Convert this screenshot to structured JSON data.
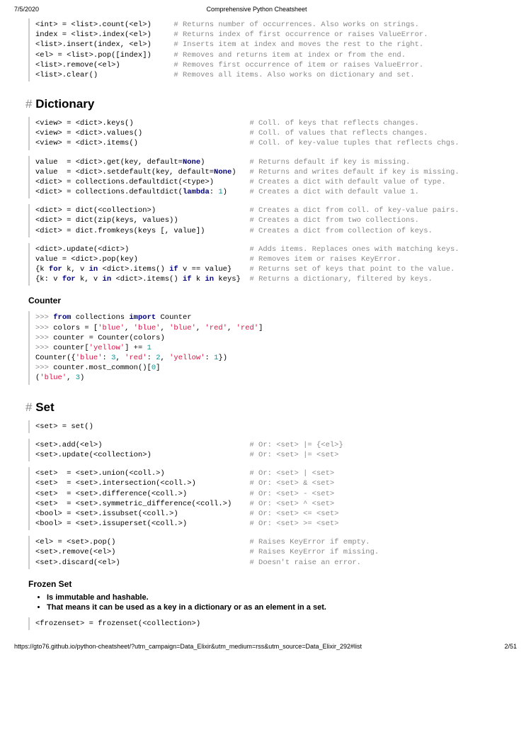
{
  "header": {
    "date": "7/5/2020",
    "title": "Comprehensive Python Cheatsheet"
  },
  "footer": {
    "url": "https://gto76.github.io/python-cheatsheet/?utm_campaign=Data_Elixir&utm_medium=rss&utm_source=Data_Elixir_292#list",
    "page": "2/51"
  },
  "sections": {
    "dictionary": {
      "hash": "#",
      "title": "Dictionary"
    },
    "set": {
      "hash": "#",
      "title": "Set"
    }
  },
  "subsections": {
    "counter": "Counter",
    "frozenset": "Frozen Set"
  },
  "bullets": {
    "fs1": "Is immutable and hashable.",
    "fs2": "That means it can be used as a key in a dictionary or as an element in a set."
  },
  "code": {
    "list_ops": "<int> = <list>.count(<el>)     # Returns number of occurrences. Also works on strings.\nindex = <list>.index(<el>)     # Returns index of first occurrence or raises ValueError.\n<list>.insert(index, <el>)     # Inserts item at index and moves the rest to the right.\n<el> = <list>.pop([index])     # Removes and returns item at index or from the end.\n<list>.remove(<el>)            # Removes first occurrence of item or raises ValueError.\n<list>.clear()                 # Removes all items. Also works on dictionary and set.",
    "dict_views": "<view> = <dict>.keys()                          # Coll. of keys that reflects changes.\n<view> = <dict>.values()                        # Coll. of values that reflects changes.\n<view> = <dict>.items()                         # Coll. of key-value tuples that reflects chgs.",
    "dict_get": "value  = <dict>.get(key, default=None)          # Returns default if key is missing.\nvalue  = <dict>.setdefault(key, default=None)   # Returns and writes default if key is missing.\n<dict> = collections.defaultdict(<type>)        # Creates a dict with default value of type.\n<dict> = collections.defaultdict(lambda: 1)     # Creates a dict with default value 1.",
    "dict_create": "<dict> = dict(<collection>)                     # Creates a dict from coll. of key-value pairs.\n<dict> = dict(zip(keys, values))                # Creates a dict from two collections.\n<dict> = dict.fromkeys(keys [, value])          # Creates a dict from collection of keys.",
    "dict_update": "<dict>.update(<dict>)                           # Adds items. Replaces ones with matching keys.\nvalue = <dict>.pop(key)                         # Removes item or raises KeyError.\n{k for k, v in <dict>.items() if v == value}    # Returns set of keys that point to the value.\n{k: v for k, v in <dict>.items() if k in keys}  # Returns a dictionary, filtered by keys.",
    "counter_ex": ">>> from collections import Counter\n>>> colors = ['blue', 'blue', 'blue', 'red', 'red']\n>>> counter = Counter(colors)\n>>> counter['yellow'] += 1\nCounter({'blue': 3, 'red': 2, 'yellow': 1})\n>>> counter.most_common()[0]\n('blue', 3)",
    "set_new": "<set> = set()",
    "set_add": "<set>.add(<el>)                                 # Or: <set> |= {<el>}\n<set>.update(<collection>)                      # Or: <set> |= <set>",
    "set_ops": "<set>  = <set>.union(<coll.>)                   # Or: <set> | <set>\n<set>  = <set>.intersection(<coll.>)            # Or: <set> & <set>\n<set>  = <set>.difference(<coll.>)              # Or: <set> - <set>\n<set>  = <set>.symmetric_difference(<coll.>)    # Or: <set> ^ <set>\n<bool> = <set>.issubset(<coll.>)                # Or: <set> <= <set>\n<bool> = <set>.issuperset(<coll.>)              # Or: <set> >= <set>",
    "set_pop": "<el> = <set>.pop()                              # Raises KeyError if empty.\n<set>.remove(<el>)                              # Raises KeyError if missing.\n<set>.discard(<el>)                             # Doesn't raise an error.",
    "frozenset_new": "<frozenset> = frozenset(<collection>)"
  }
}
